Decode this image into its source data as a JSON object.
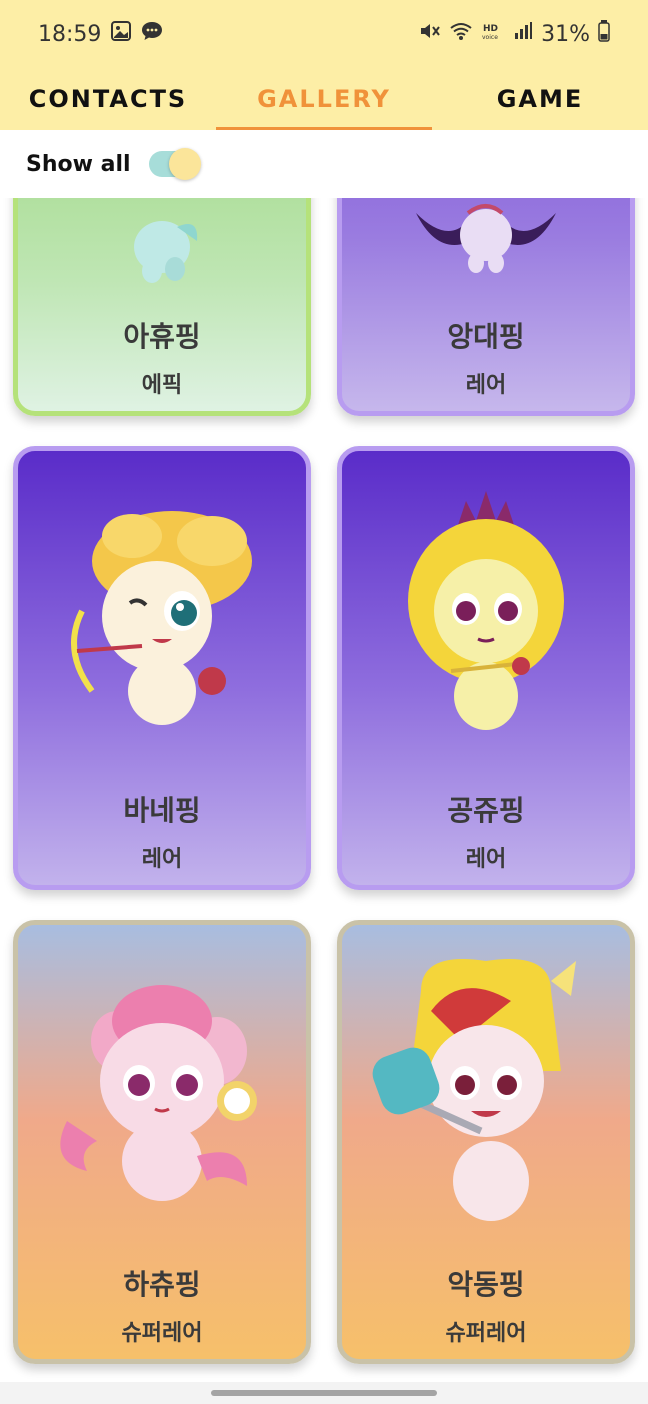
{
  "status": {
    "time": "18:59",
    "battery": "31%"
  },
  "tabs": [
    {
      "label": "CONTACTS"
    },
    {
      "label": "GALLERY"
    },
    {
      "label": "GAME"
    }
  ],
  "filter": {
    "label": "Show all",
    "toggle_on": true
  },
  "cards": [
    {
      "name": "아휴핑",
      "rarity": "에픽",
      "theme": "green"
    },
    {
      "name": "앙대핑",
      "rarity": "레어",
      "theme": "purple"
    },
    {
      "name": "바네핑",
      "rarity": "레어",
      "theme": "purple"
    },
    {
      "name": "공쥬핑",
      "rarity": "레어",
      "theme": "purple"
    },
    {
      "name": "하츄핑",
      "rarity": "슈퍼레어",
      "theme": "orange"
    },
    {
      "name": "악동핑",
      "rarity": "슈퍼레어",
      "theme": "orange"
    }
  ],
  "colors": {
    "header_bg": "#fdeea6",
    "active_tab": "#f0923a",
    "card_green_border": "#b5e27a",
    "card_purple_border": "#b89cf0",
    "card_orange_border": "#c9c2a8"
  }
}
